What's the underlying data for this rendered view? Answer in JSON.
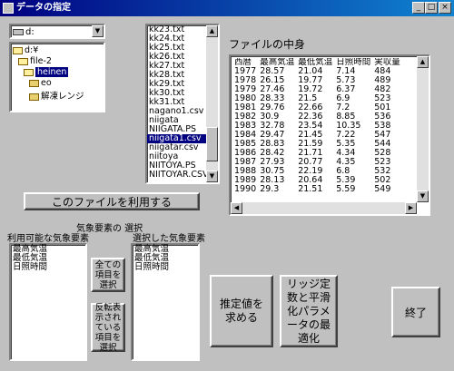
{
  "window": {
    "title": "データの指定",
    "min_glyph": "_",
    "max_glyph": "□",
    "close_glyph": "×"
  },
  "drive_select": {
    "value": "d:"
  },
  "folder_tree": {
    "items": [
      {
        "label": "d:¥",
        "level": 0,
        "icon": "open-folder-icon",
        "selected": false
      },
      {
        "label": "file-2",
        "level": 1,
        "icon": "open-folder-icon",
        "selected": false
      },
      {
        "label": "heinen",
        "level": 2,
        "icon": "open-folder-icon",
        "selected": true
      },
      {
        "label": "eo",
        "level": 3,
        "icon": "folder-icon",
        "selected": false
      },
      {
        "label": "解凍レンジ",
        "level": 3,
        "icon": "folder-icon",
        "selected": false
      }
    ]
  },
  "file_list": {
    "items": [
      {
        "label": "kk23.txt",
        "selected": false
      },
      {
        "label": "kk24.txt",
        "selected": false
      },
      {
        "label": "kk25.txt",
        "selected": false
      },
      {
        "label": "kk26.txt",
        "selected": false
      },
      {
        "label": "kk27.txt",
        "selected": false
      },
      {
        "label": "kk28.txt",
        "selected": false
      },
      {
        "label": "kk29.txt",
        "selected": false
      },
      {
        "label": "kk30.txt",
        "selected": false
      },
      {
        "label": "kk31.txt",
        "selected": false
      },
      {
        "label": "nagano1.csv",
        "selected": false
      },
      {
        "label": "niigata",
        "selected": false
      },
      {
        "label": "NIIGATA.PS",
        "selected": false
      },
      {
        "label": "niigata1.csv",
        "selected": true
      },
      {
        "label": "niigatar.csv",
        "selected": false
      },
      {
        "label": "niitoya",
        "selected": false
      },
      {
        "label": "NIITOYA.PS",
        "selected": false
      },
      {
        "label": "NIITOYAR.CSV",
        "selected": false
      }
    ]
  },
  "file_contents": {
    "title": "ファイルの中身",
    "columns": [
      "西暦",
      "最高気温",
      "最低気温",
      "日照時間",
      "実収量"
    ],
    "rows": [
      [
        "1977",
        "28.57",
        "21.04",
        "7.14",
        "484"
      ],
      [
        "1978",
        "26.15",
        "19.77",
        "5.73",
        "489"
      ],
      [
        "1979",
        "27.46",
        "19.72",
        "6.37",
        "482"
      ],
      [
        "1980",
        "28.33",
        "21.5",
        "6.9",
        "523"
      ],
      [
        "1981",
        "29.76",
        "22.66",
        "7.2",
        "501"
      ],
      [
        "1982",
        "30.9",
        "22.36",
        "8.85",
        "536"
      ],
      [
        "1983",
        "32.78",
        "23.54",
        "10.35",
        "538"
      ],
      [
        "1984",
        "29.47",
        "21.45",
        "7.22",
        "547"
      ],
      [
        "1985",
        "28.83",
        "21.59",
        "5.35",
        "544"
      ],
      [
        "1986",
        "28.42",
        "21.71",
        "4.34",
        "528"
      ],
      [
        "1987",
        "27.93",
        "20.77",
        "4.35",
        "523"
      ],
      [
        "1988",
        "30.75",
        "22.19",
        "6.8",
        "532"
      ],
      [
        "1989",
        "28.13",
        "20.64",
        "5.39",
        "502"
      ],
      [
        "1990",
        "29.3",
        "21.51",
        "5.59",
        "549"
      ]
    ]
  },
  "use_file_button": "このファイルを利用する",
  "element_selection": {
    "title": "気象要素の 選択",
    "available_label": "利用可能な気象要素",
    "selected_label": "選択した気象要素",
    "available_items": [
      "最高気温",
      "最低気温",
      "日照時間"
    ],
    "selected_items": [
      "最高気温",
      "最低気温",
      "日照時間"
    ],
    "select_all_button": "全ての項目を選択",
    "select_highlighted_button": "反転表示されている項目を選択"
  },
  "buttons": {
    "estimate": "推定値を求める",
    "optimize": "リッジ定数と平滑化パラメータの最適化",
    "exit": "終了"
  }
}
